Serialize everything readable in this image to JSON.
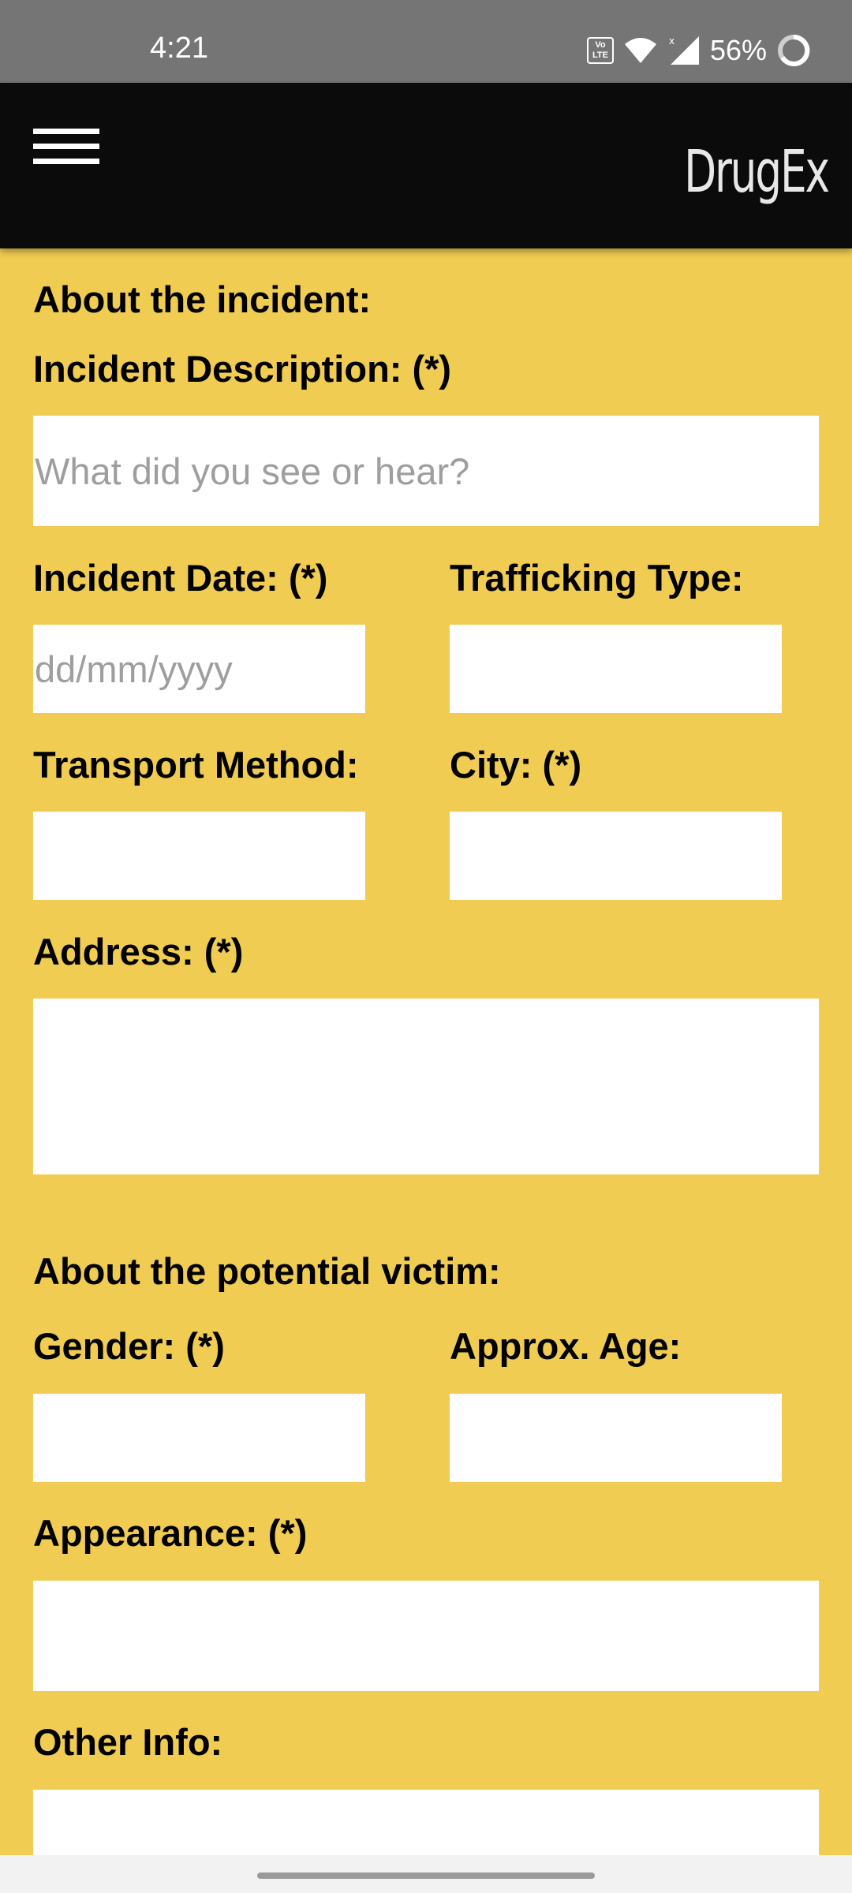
{
  "status_bar": {
    "time": "4:21",
    "volte_text": "Vo LTE",
    "battery_percent": "56%",
    "icons": [
      "volte-icon",
      "wifi-icon",
      "signal-icon",
      "battery-ring-icon"
    ]
  },
  "app_bar": {
    "menu_icon": "hamburger-menu-icon",
    "logo_text": "DrugEx"
  },
  "incident_section": {
    "heading": "About the incident:",
    "description": {
      "label": "Incident Description: (*)",
      "placeholder": "What did you see or hear?",
      "value": ""
    },
    "date": {
      "label": "Incident Date: (*)",
      "placeholder": "dd/mm/yyyy",
      "value": ""
    },
    "trafficking_type": {
      "label": "Trafficking Type:",
      "value": ""
    },
    "transport_method": {
      "label": "Transport Method:",
      "value": ""
    },
    "city": {
      "label": "City: (*)",
      "value": ""
    },
    "address": {
      "label": "Address: (*)",
      "value": ""
    }
  },
  "victim_section": {
    "heading": "About the potential victim:",
    "gender": {
      "label": "Gender: (*)",
      "value": ""
    },
    "approx_age": {
      "label": "Approx. Age:",
      "value": ""
    },
    "appearance": {
      "label": "Appearance: (*)",
      "value": ""
    },
    "other_info": {
      "label": "Other Info:",
      "value": ""
    }
  },
  "colors": {
    "background": "#f0cc52",
    "app_bar": "#0b0b0b",
    "status_bar": "#757575",
    "field": "#ffffff"
  }
}
